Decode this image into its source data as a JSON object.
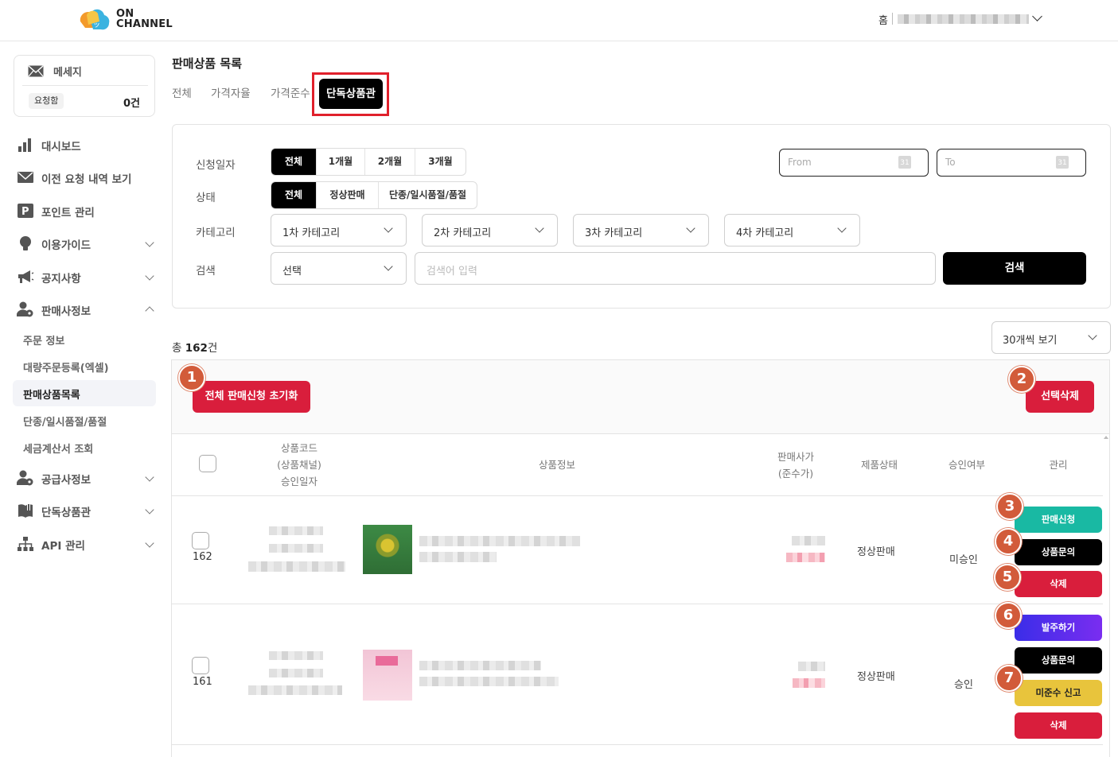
{
  "header": {
    "logo_line1": "ON",
    "logo_line2": "CHANNEL",
    "home_label": "홈"
  },
  "sidebar": {
    "message": {
      "title": "메세지",
      "chip": "요청함",
      "count": "0건"
    },
    "items": [
      {
        "label": "대시보드",
        "icon": "bar-chart-icon"
      },
      {
        "label": "이전 요청 내역 보기",
        "icon": "envelope-icon"
      },
      {
        "label": "포인트 관리",
        "icon": "points-p-icon"
      },
      {
        "label": "이용가이드",
        "icon": "lightbulb-icon"
      },
      {
        "label": "공지사항",
        "icon": "megaphone-icon"
      },
      {
        "label": "판매사정보",
        "icon": "user-settings-icon"
      },
      {
        "label": "공급사정보",
        "icon": "user-settings-icon"
      },
      {
        "label": "단독상품관",
        "icon": "book-icon"
      },
      {
        "label": "API 관리",
        "icon": "network-icon"
      }
    ],
    "sub_items": [
      "주문 정보",
      "대량주문등록(엑셀)",
      "판매상품목록",
      "단종/일시품절/품절",
      "세금계산서 조회"
    ]
  },
  "main": {
    "title": "판매상품 목록",
    "tabs": [
      "전체",
      "가격자율",
      "가격준수",
      "단독상품관"
    ],
    "filters": {
      "labels": [
        "신청일자",
        "상태",
        "카테고리",
        "검색"
      ],
      "period": [
        "전체",
        "1개월",
        "2개월",
        "3개월"
      ],
      "status": [
        "전체",
        "정상판매",
        "단종/일시품절/품절"
      ],
      "date_from": "From",
      "date_to": "To",
      "calendar_day": "31",
      "categories": [
        "1차 카테고리",
        "2차 카테고리",
        "3차 카테고리",
        "4차 카테고리"
      ],
      "search_select": "선택",
      "search_placeholder": "검색어 입력",
      "search_button": "검색"
    },
    "total_prefix": "총 ",
    "total_count": "162",
    "total_suffix": "건",
    "per_page": "30개씩 보기",
    "reset_button": "전체 판매신청 초기화",
    "delete_selected_button": "선택삭제",
    "columns": {
      "code_line1": "상품코드",
      "code_line2": "(상품채널)",
      "code_line3": "승인일자",
      "info": "상품정보",
      "price_line1": "판매사가",
      "price_line2": "(준수가)",
      "status": "제품상태",
      "approval": "승인여부",
      "manage": "관리"
    },
    "rows": [
      {
        "num": "162",
        "status": "정상판매",
        "approval": "미승인",
        "actions": [
          "판매신청",
          "상품문의",
          "삭제"
        ]
      },
      {
        "num": "161",
        "status": "정상판매",
        "approval": "승인",
        "actions": [
          "발주하기",
          "상품문의",
          "미준수 신고",
          "삭제"
        ]
      }
    ],
    "markers": [
      "1",
      "2",
      "3",
      "4",
      "5",
      "6",
      "7"
    ]
  },
  "colors": {
    "accent_red": "#d91e3c",
    "teal": "#19b9a3",
    "purple": "#5a2df0",
    "yellow": "#e8c43c",
    "highlight_box": "#e0202b",
    "marker": "#d25b3a"
  }
}
